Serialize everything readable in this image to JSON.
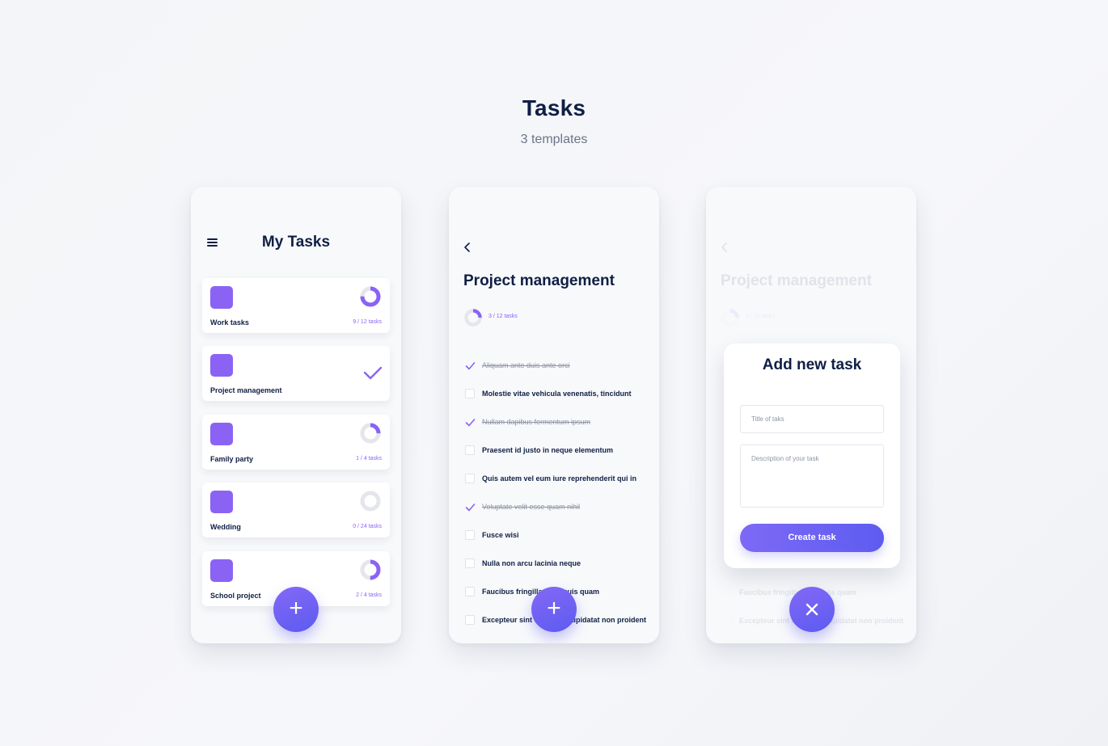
{
  "header": {
    "title": "Tasks",
    "subtitle": "3 templates"
  },
  "phone1": {
    "title": "My Tasks",
    "cards": [
      {
        "name": "Work tasks",
        "count": "9 / 12 tasks",
        "progress": 0.75
      },
      {
        "name": "Project management",
        "count": "",
        "progress": 1.0,
        "completed": true
      },
      {
        "name": "Family party",
        "count": "1 / 4 tasks",
        "progress": 0.25
      },
      {
        "name": "Wedding",
        "count": "0 / 24 tasks",
        "progress": 0.0
      },
      {
        "name": "School project",
        "count": "2 / 4 tasks",
        "progress": 0.5
      }
    ],
    "fab": "+"
  },
  "phone2": {
    "title": "Project management",
    "progress_text": "3 / 12 tasks",
    "progress": 0.25,
    "tasks": [
      {
        "text": "Aliquam ante duis ante orci",
        "done": true
      },
      {
        "text": "Molestie vitae vehicula venenatis, tincidunt",
        "done": false
      },
      {
        "text": "Nullam dapibus fermentum ipsum",
        "done": true
      },
      {
        "text": "Praesent id justo in neque elementum",
        "done": false
      },
      {
        "text": "Quis autem vel eum iure reprehenderit qui in",
        "done": false
      },
      {
        "text": "Voluptate velit esse quam nihil",
        "done": true
      },
      {
        "text": "Fusce wisi",
        "done": false
      },
      {
        "text": "Nulla non arcu lacinia neque",
        "done": false
      },
      {
        "text": "Faucibus fringilla vitae quis quam",
        "done": false
      },
      {
        "text": "Excepteur sint occaecat cupidatat non proident",
        "done": false
      }
    ],
    "fab": "+"
  },
  "phone3": {
    "background_title": "Project management",
    "modal_title": "Add new task",
    "title_placeholder": "Title of taks",
    "description_placeholder": "Description of your task",
    "create_label": "Create task",
    "close": "×"
  },
  "colors": {
    "accent": "#8a63f5",
    "accent_dark": "#5c5bf0",
    "text": "#0f1f45",
    "muted": "#8d94a6"
  }
}
